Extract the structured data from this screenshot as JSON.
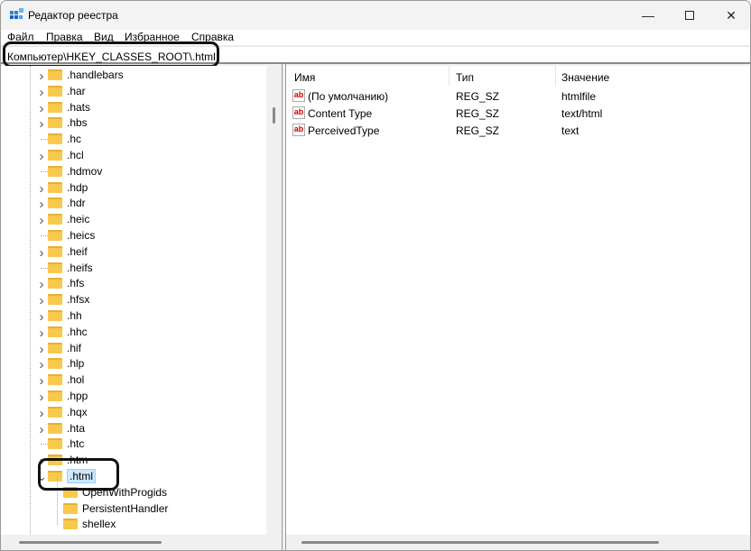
{
  "window": {
    "title": "Редактор реестра"
  },
  "menu": [
    "Файл",
    "Правка",
    "Вид",
    "Избранное",
    "Справка"
  ],
  "address": "Компьютер\\HKEY_CLASSES_ROOT\\.html",
  "tree": [
    {
      "label": ".handlebars",
      "expandable": true
    },
    {
      "label": ".har",
      "expandable": true
    },
    {
      "label": ".hats",
      "expandable": true
    },
    {
      "label": ".hbs",
      "expandable": true
    },
    {
      "label": ".hc",
      "expandable": false
    },
    {
      "label": ".hcl",
      "expandable": true
    },
    {
      "label": ".hdmov",
      "expandable": false
    },
    {
      "label": ".hdp",
      "expandable": true
    },
    {
      "label": ".hdr",
      "expandable": true
    },
    {
      "label": ".heic",
      "expandable": true
    },
    {
      "label": ".heics",
      "expandable": false
    },
    {
      "label": ".heif",
      "expandable": true
    },
    {
      "label": ".heifs",
      "expandable": false
    },
    {
      "label": ".hfs",
      "expandable": true
    },
    {
      "label": ".hfsx",
      "expandable": true
    },
    {
      "label": ".hh",
      "expandable": true
    },
    {
      "label": ".hhc",
      "expandable": true
    },
    {
      "label": ".hif",
      "expandable": true
    },
    {
      "label": ".hlp",
      "expandable": true
    },
    {
      "label": ".hol",
      "expandable": true
    },
    {
      "label": ".hpp",
      "expandable": true
    },
    {
      "label": ".hqx",
      "expandable": true
    },
    {
      "label": ".hta",
      "expandable": true
    },
    {
      "label": ".htc",
      "expandable": false
    },
    {
      "label": ".htm",
      "expandable": true
    },
    {
      "label": ".html",
      "expandable": true,
      "expanded": true,
      "selected": true
    }
  ],
  "children": [
    "OpenWithProgids",
    "PersistentHandler",
    "shellex"
  ],
  "columns": {
    "name": "Имя",
    "type": "Тип",
    "value": "Значение"
  },
  "values": [
    {
      "name": "(По умолчанию)",
      "type": "REG_SZ",
      "data": "htmlfile"
    },
    {
      "name": "Content Type",
      "type": "REG_SZ",
      "data": "text/html"
    },
    {
      "name": "PerceivedType",
      "type": "REG_SZ",
      "data": "text"
    }
  ],
  "value_icon": "ab"
}
